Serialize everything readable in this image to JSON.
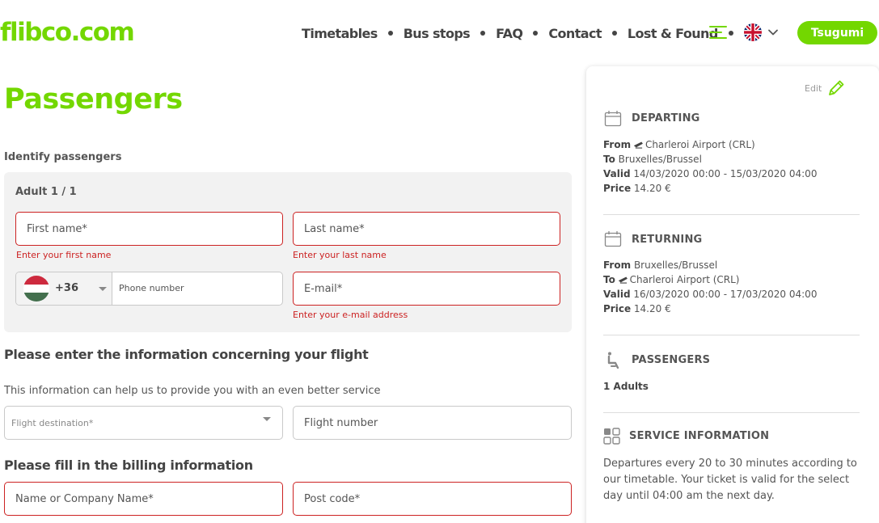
{
  "header": {
    "logo": "flibco.com",
    "nav": [
      "Timetables",
      "Bus stops",
      "FAQ",
      "Contact",
      "Lost & Found"
    ],
    "user_button": "Tsugumi",
    "colors": {
      "brand": "#73d700",
      "error": "#cc2222"
    }
  },
  "page_title": "Passengers",
  "identify_label": "Identify passengers",
  "passenger": {
    "label": "Adult 1 / 1",
    "first_name": {
      "placeholder": "First name*",
      "error": "Enter your first name"
    },
    "last_name": {
      "placeholder": "Last name*",
      "error": "Enter your last name"
    },
    "phone": {
      "prefix": "+36",
      "placeholder": "Phone number"
    },
    "email": {
      "placeholder": "E-mail*",
      "error": "Enter your e-mail address"
    }
  },
  "flight": {
    "heading": "Please enter the information concerning your flight",
    "info": "This information can help us to provide you with an even better service",
    "destination_placeholder": "Flight destination*",
    "number_placeholder": "Flight number"
  },
  "billing": {
    "heading": "Please fill in the billing information",
    "name_placeholder": "Name or Company Name*",
    "postcode_placeholder": "Post code*"
  },
  "summary": {
    "edit": "Edit",
    "departing": {
      "heading": "DEPARTING",
      "from_label": "From",
      "from": "Charleroi Airport (CRL)",
      "to_label": "To",
      "to": "Bruxelles/Brussel",
      "valid_label": "Valid",
      "valid": "14/03/2020 00:00 - 15/03/2020 04:00",
      "price_label": "Price",
      "price": "14.20 €"
    },
    "returning": {
      "heading": "RETURNING",
      "from_label": "From",
      "from": "Bruxelles/Brussel",
      "to_label": "To",
      "to": "Charleroi Airport (CRL)",
      "valid_label": "Valid",
      "valid": "16/03/2020 00:00 - 17/03/2020 04:00",
      "price_label": "Price",
      "price": "14.20 €"
    },
    "passengers": {
      "heading": "PASSENGERS",
      "value": "1 Adults"
    },
    "service": {
      "heading": "SERVICE INFORMATION",
      "text": "Departures every 20 to 30 minutes according to our timetable. Your ticket is valid for the select day until 04:00 am the next day."
    }
  }
}
